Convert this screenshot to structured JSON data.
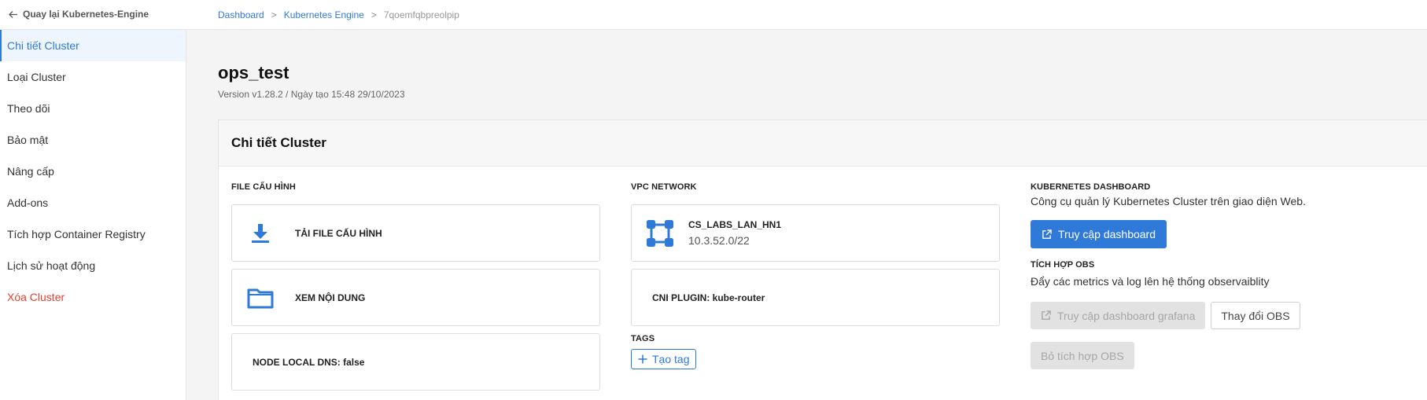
{
  "colors": {
    "accent": "#2f7ad8",
    "danger": "#e8402e",
    "disabled_bg": "#e2e2e2"
  },
  "topbar": {
    "back_label": "Quay lại Kubernetes-Engine",
    "breadcrumb": {
      "home": "Dashboard",
      "section": "Kubernetes Engine",
      "current": "7qoemfqbpreolpip",
      "separator": ">"
    }
  },
  "sidebar": {
    "items": [
      {
        "label": "Chi tiết Cluster",
        "active": true
      },
      {
        "label": "Loại Cluster"
      },
      {
        "label": "Theo dõi"
      },
      {
        "label": "Bảo mật"
      },
      {
        "label": "Nâng cấp"
      },
      {
        "label": "Add-ons"
      },
      {
        "label": "Tích hợp Container Registry"
      },
      {
        "label": "Lịch sử hoạt động"
      },
      {
        "label": "Xóa Cluster",
        "danger": true
      }
    ]
  },
  "page": {
    "title": "ops_test",
    "subtitle": "Version v1.28.2 / Ngày tạo 15:48 29/10/2023"
  },
  "panel": {
    "title": "Chi tiết Cluster",
    "config": {
      "section_label": "FILE CẤU HÌNH",
      "download_label": "TẢI FILE CẤU HÌNH",
      "view_label": "XEM NỘI DUNG",
      "node_local_dns": "NODE LOCAL DNS: false",
      "icons": {
        "download": "download-icon",
        "folder": "folder-icon"
      }
    },
    "network": {
      "section_label": "VPC NETWORK",
      "vpc_name": "CS_LABS_LAN_HN1",
      "vpc_cidr": "10.3.52.0/22",
      "cni_plugin": "CNI PLUGIN: kube-router",
      "tags_label": "TAGS",
      "create_tag": "Tạo tag",
      "icons": {
        "network": "network-icon",
        "plus": "plus-icon"
      }
    },
    "dashboard": {
      "section_label": "KUBERNETES DASHBOARD",
      "description": "Công cụ quản lý Kubernetes Cluster trên giao diện Web.",
      "access_button": "Truy cập dashboard",
      "obs_label": "TÍCH HỢP OBS",
      "obs_description": "Đẩy các metrics và log lên hệ thống observaiblity",
      "grafana_button": "Truy cập dashboard grafana",
      "change_obs_button": "Thay đổi OBS",
      "remove_obs_button": "Bỏ tích hợp OBS",
      "icons": {
        "external": "external-link-icon"
      }
    }
  }
}
